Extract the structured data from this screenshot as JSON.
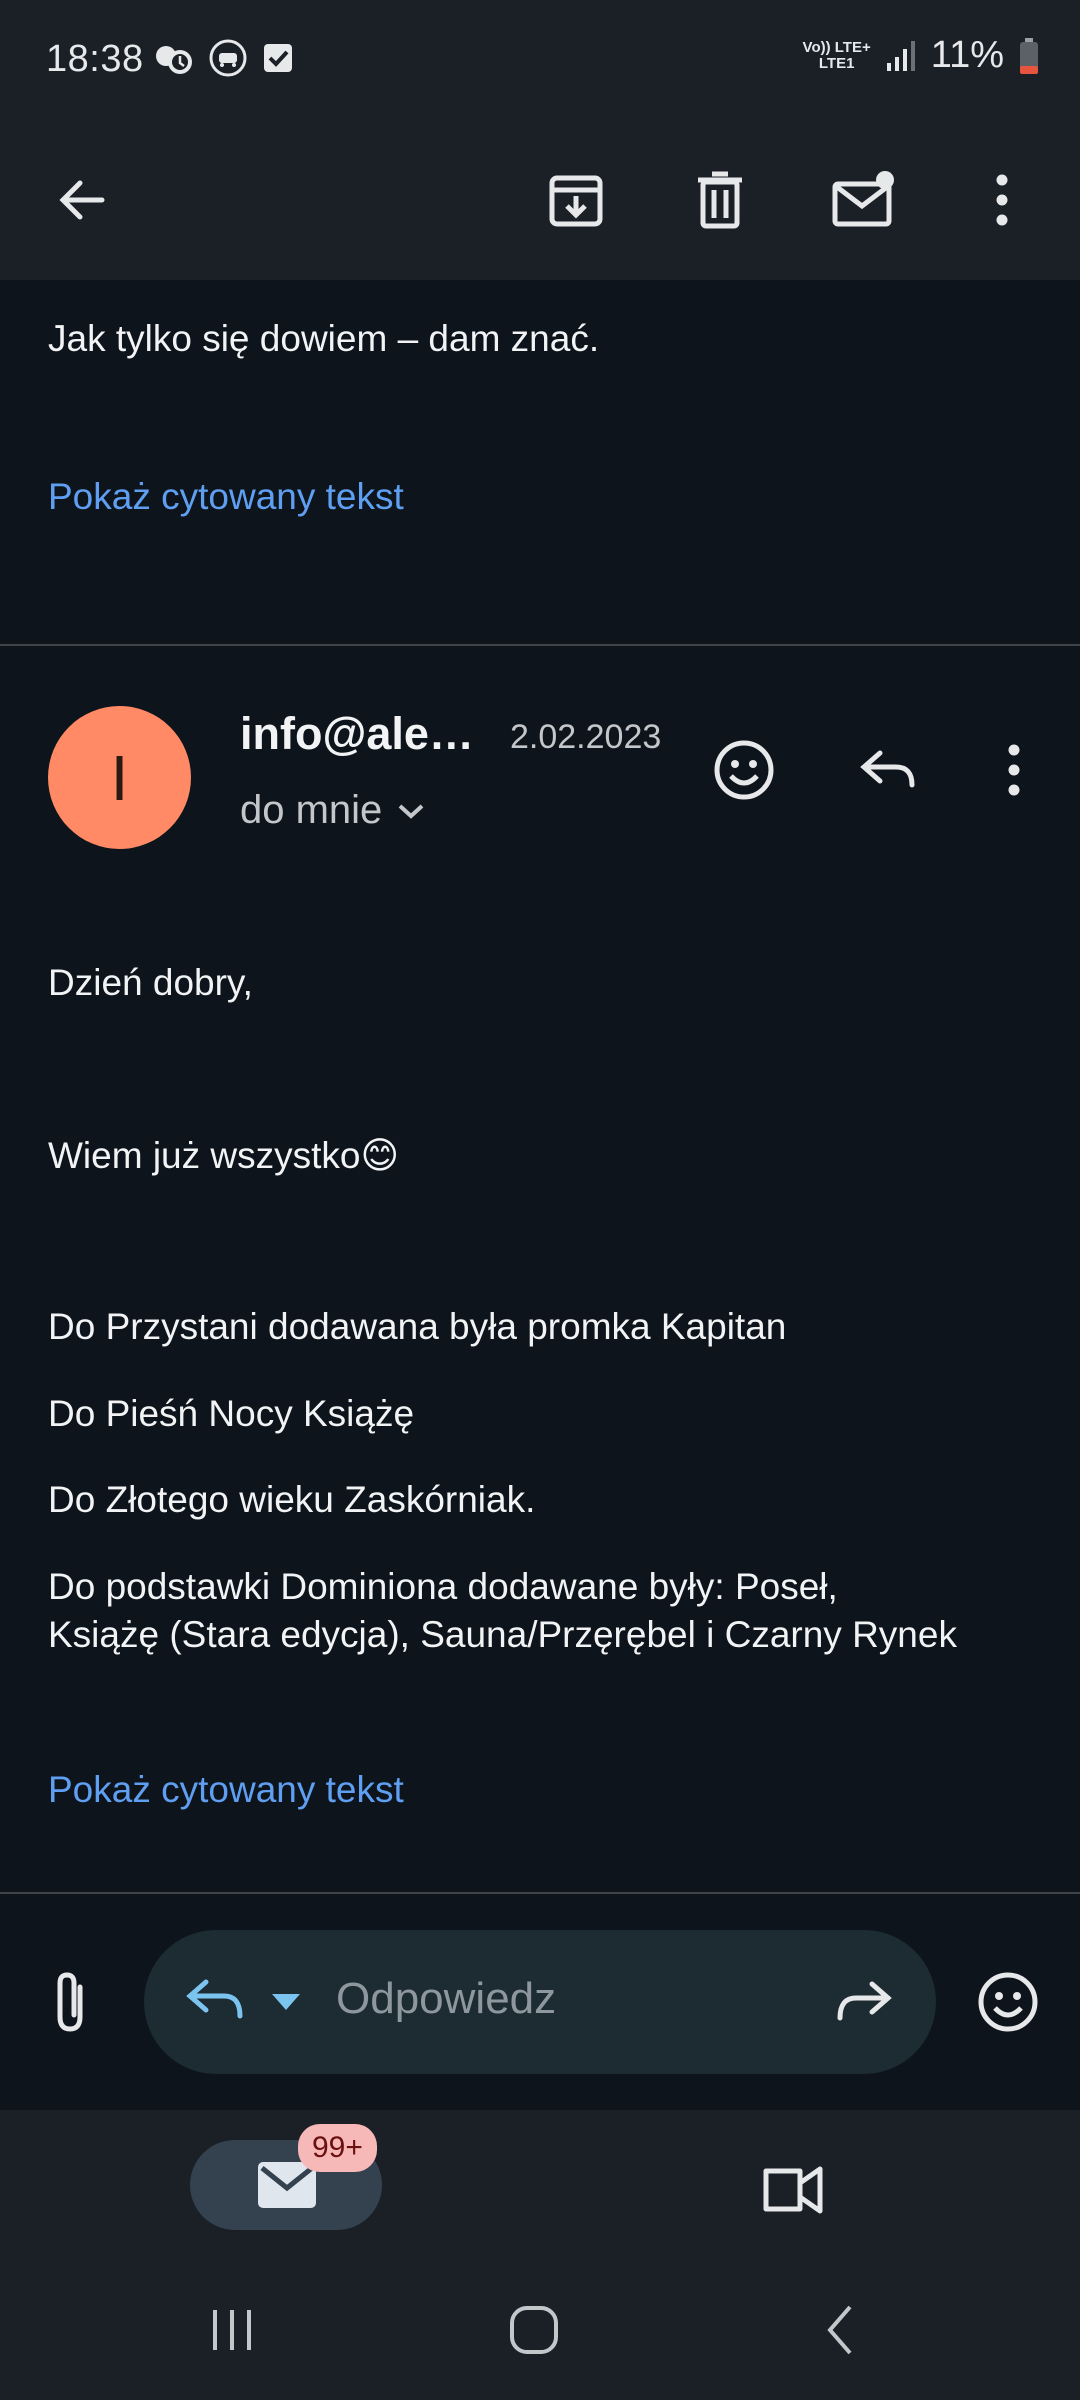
{
  "status_bar": {
    "time": "18:38",
    "network_top": "Vo)) LTE+",
    "network_bottom": "LTE1",
    "battery": "11%"
  },
  "toolbar": {
    "back": "arrow-left-icon",
    "archive": "archive-icon",
    "delete": "trash-icon",
    "mark_unread": "mail-unread-icon",
    "more": "more-vert-icon"
  },
  "previous_message": {
    "body": "Jak tylko się dowiem – dam znać.",
    "show_quoted": "Pokaż cytowany tekst"
  },
  "message": {
    "avatar_letter": "I",
    "sender": "info@ale…",
    "date": "2.02.2023",
    "recipient": "do mnie",
    "body": [
      "Dzień dobry,",
      "Wiem już wszystko😊",
      "Do Przystani dodawana była promka Kapitan",
      "Do Pieśń Nocy Książę",
      "Do Złotego wieku Zaskórniak.",
      "Do podstawki Dominiona dodawane były: Poseł,",
      "Książę (Stara edycja), Sauna/Przęrębel i Czarny Rynek"
    ],
    "show_quoted": "Pokaż cytowany tekst"
  },
  "reply_bar": {
    "placeholder": "Odpowiedz"
  },
  "bottom_nav": {
    "mail_badge": "99+"
  },
  "colors": {
    "accent_link": "#5f9ff2",
    "avatar_bg": "#ff8a65",
    "reply_icon": "#7cc4f0",
    "badge_bg": "#f7b8b8"
  }
}
